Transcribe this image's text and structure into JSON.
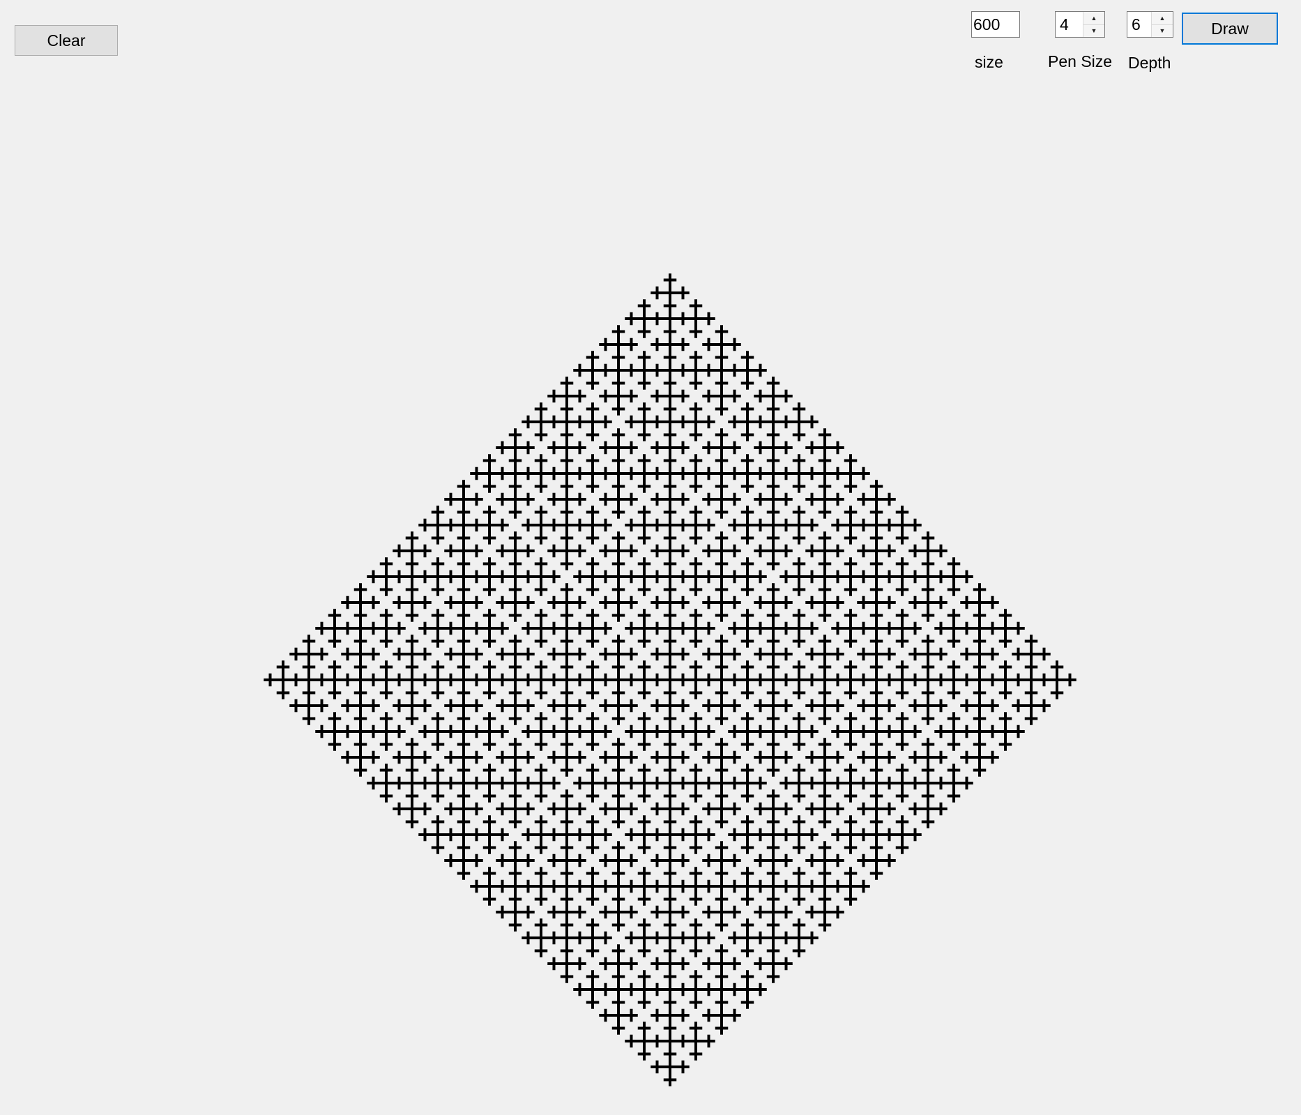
{
  "toolbar": {
    "clear_label": "Clear",
    "draw_label": "Draw",
    "size_value": "600",
    "size_label": "size",
    "pen_size_value": "4",
    "pen_size_label": "Pen Size",
    "depth_value": "6",
    "depth_label": "Depth"
  },
  "canvas": {
    "fractal": "cross fractal (T-square style plus marks)",
    "stroke_color": "#000000",
    "background_color": "#f0f0f0"
  },
  "colors": {
    "window_bg": "#f0f0f0",
    "button_bg": "#e1e1e1",
    "focus_border": "#0078d7"
  }
}
